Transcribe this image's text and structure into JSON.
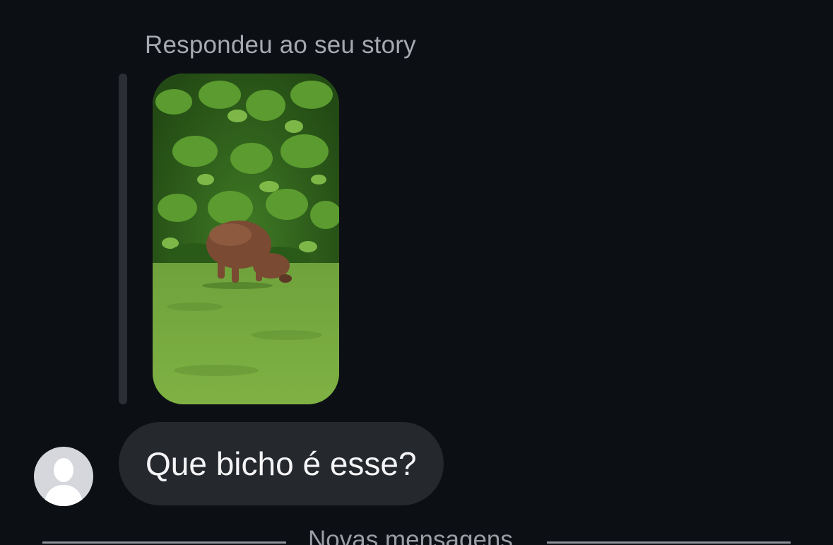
{
  "conversation": {
    "reply_context_label": "Respondeu ao seu story",
    "story_preview": {
      "icon": "story-photo-capybara"
    },
    "message": {
      "text": "Que bicho é esse?",
      "sender_avatar_icon": "default-person-avatar-icon"
    },
    "new_messages_divider": {
      "label": "Novas mensagens"
    }
  },
  "colors": {
    "background": "#0c0f14",
    "bubble": "#25282d",
    "quote_bar": "#2b2e34",
    "secondary_text": "#a7a9b1",
    "primary_text": "#f5f5f7",
    "avatar_bg": "#d6d7dc"
  }
}
